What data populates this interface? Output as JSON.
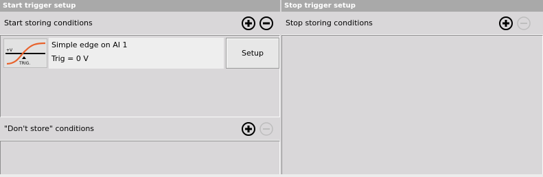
{
  "start_trigger": {
    "title": "Start trigger setup",
    "start_conditions": {
      "label": "Start storing conditions",
      "items": [
        {
          "title": "Simple edge on AI 1",
          "detail": "Trig = 0 V",
          "thumbnail_label": "TRIG.",
          "thumbnail_axis_label": "+V",
          "setup_label": "Setup"
        }
      ]
    },
    "dont_store_conditions": {
      "label": "\"Don't store\" conditions",
      "items": []
    }
  },
  "stop_trigger": {
    "title": "Stop trigger setup",
    "stop_conditions": {
      "label": "Stop storing conditions",
      "items": []
    }
  },
  "icons": {
    "add": "plus-circle-icon",
    "remove": "minus-circle-icon"
  },
  "colors": {
    "header_bg": "#a9a9a9",
    "panel_bg": "#d9d7d9",
    "curve": "#e8622c",
    "disabled_icon": "#bdbdbd"
  }
}
